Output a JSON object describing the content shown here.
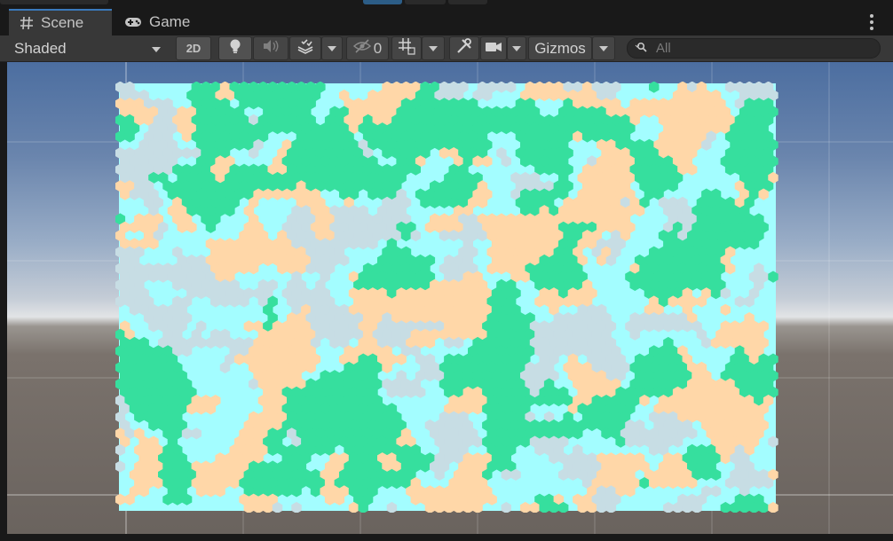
{
  "tabs": [
    {
      "label": "Scene",
      "icon": "hash-icon",
      "active": true
    },
    {
      "label": "Game",
      "icon": "gamepad-icon",
      "active": false
    }
  ],
  "toolbar": {
    "draw_mode": "Shaded",
    "mode_2d_label": "2D",
    "hidden_count": "0",
    "gizmos_label": "Gizmos",
    "search_placeholder": "All"
  },
  "colors": {
    "water": "#a3fdff",
    "sand": "#ffd7a8",
    "grass": "#36df9e",
    "stone": "#c7dde4",
    "tab_accent": "#3a79bb"
  }
}
